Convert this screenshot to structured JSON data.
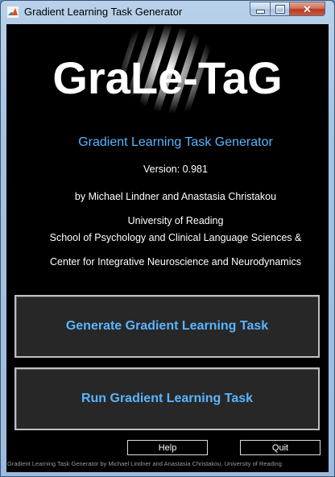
{
  "window": {
    "title": "Gradient Learning Task Generator",
    "icon": "matlab-icon",
    "controls": {
      "minimize": "minimize-icon",
      "maximize": "maximize-icon",
      "close": "close-icon"
    }
  },
  "logo": {
    "text": "GraLe-TaG"
  },
  "subtitle": "Gradient Learning Task Generator",
  "version": "Version: 0.981",
  "authors": "by Michael Lindner and Anastasia Christakou",
  "affiliation": {
    "line1": "University of Reading",
    "line2": "School of Psychology and Clinical Language Sciences &",
    "line3": "Center for Integrative Neuroscience and Neurodynamics"
  },
  "buttons": {
    "generate": "Generate Gradient Learning Task",
    "run": "Run Gradient Learning Task",
    "help": "Help",
    "quit": "Quit"
  },
  "footer": "Gradient Learning Task Generator by Michael Lindner and Anastasia Christakou, University of Reading",
  "colors": {
    "background": "#000000",
    "accent": "#5ab4ff",
    "button_face": "#272727",
    "text": "#ffffff"
  }
}
